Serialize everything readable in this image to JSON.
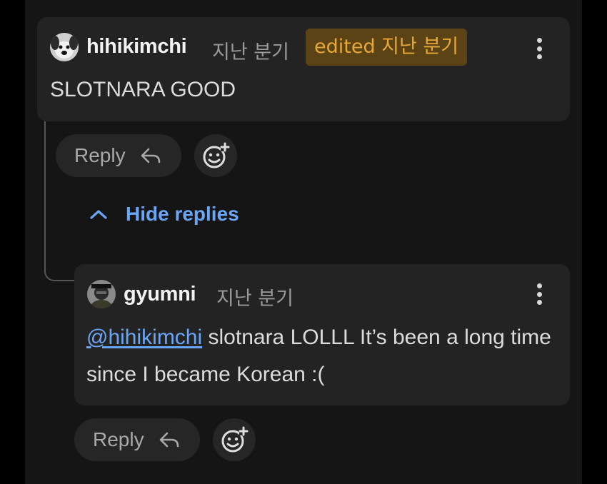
{
  "comments": [
    {
      "username": "hihikimchi",
      "time": "지난 분기",
      "edited_label": "edited 지난 분기",
      "text": "SLOTNARA GOOD",
      "reply_label": "Reply",
      "avatar_icon": "dog-avatar-icon"
    },
    {
      "username": "gyumni",
      "time": "지난 분기",
      "mention": "@hihikimchi",
      "text": "slotnara LOLLL It’s been a long time since I became Korean :(",
      "reply_label": "Reply",
      "avatar_icon": "user-avatar-icon"
    }
  ],
  "hide_replies_label": "Hide replies",
  "colors": {
    "background": "#151515",
    "card": "#232323",
    "link": "#6aa6f5",
    "edited_bg": "#5c4316",
    "edited_text": "#e7a83a"
  }
}
